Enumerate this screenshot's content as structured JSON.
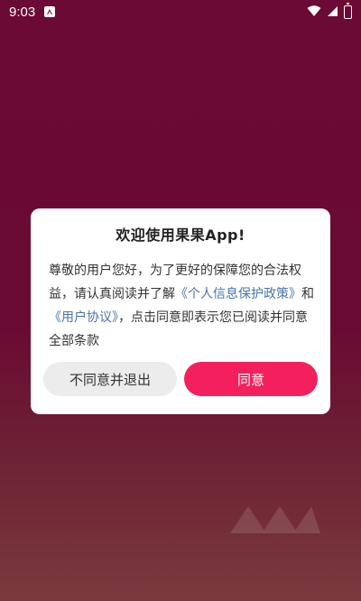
{
  "status_bar": {
    "time": "9:03",
    "notification_icon": "a-icon",
    "icons": [
      "wifi-icon",
      "signal-icon",
      "battery-icon"
    ]
  },
  "dialog": {
    "title": "欢迎使用果果App!",
    "body_prefix": "尊敬的用户您好，为了更好的保障您的合法权益，请认真阅读并了解",
    "privacy_link": "《个人信息保护政策》",
    "conj": "和",
    "user_agreement_link": "《用户协议》",
    "body_suffix": "，点击同意即表示您已阅读并同意全部条款",
    "disagree_label": "不同意并退出",
    "agree_label": "同意"
  },
  "colors": {
    "background": "#6b0a34",
    "agree_button": "#f4205e",
    "disagree_button": "#ececec",
    "link": "#4a74a8"
  }
}
